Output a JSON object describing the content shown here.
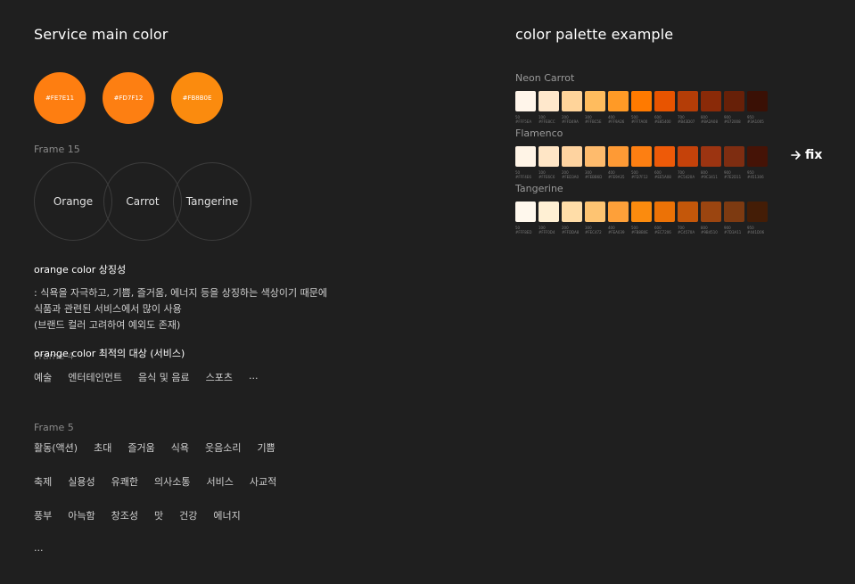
{
  "left": {
    "title": "Service main color",
    "main_colors": [
      {
        "hex": "#FE7E11",
        "label": "#FE7E11"
      },
      {
        "hex": "#FD7F12",
        "label": "#FD7F12"
      },
      {
        "hex": "#FB8B0E",
        "label": "#FB8B0E"
      }
    ],
    "frame15": {
      "label": "Frame 15",
      "rings": [
        "Orange",
        "Carrot",
        "Tangerine"
      ]
    },
    "symbolism": {
      "title": "orange color 상징성",
      "lines": [
        ": 식욕을 자극하고, 기쁨, 즐거움, 에너지 등을 상징하는 색상이기 때문에",
        "식품과 관련된 서비스에서 많이 사용",
        "(브랜드 컬러 고려하여 예외도 존재)"
      ]
    },
    "target": {
      "title": "orange color  최적의 대상 (서비스)",
      "frame_label": "Frame 4",
      "tags": [
        "예술",
        "엔터테인먼트",
        "음식 및 음료",
        "스포츠",
        "..."
      ]
    },
    "frame5": {
      "label": "Frame 5",
      "rows": [
        [
          "활동(액션)",
          "초대",
          "즐거움",
          "식욕",
          "웃음소리",
          "기쁨"
        ],
        [
          "축제",
          "실용성",
          "유쾌한",
          "의사소통",
          "서비스",
          "사교적"
        ],
        [
          "풍부",
          "아늑함",
          "창조성",
          "맛",
          "건강",
          "에너지"
        ]
      ],
      "ellipsis": "..."
    }
  },
  "right": {
    "title": "color palette example",
    "fix_label": "fix",
    "palettes": [
      {
        "name": "Neon Carrot",
        "colors": [
          "#FFF5EA",
          "#FFE8CC",
          "#FFD49A",
          "#FFBC5E",
          "#FF9A26",
          "#FF7A00",
          "#E85400",
          "#B43D07",
          "#8A2A08",
          "#672008",
          "#3A1005"
        ],
        "labels": [
          [
            "50",
            "#FFF5EA"
          ],
          [
            "100",
            "#FFE8CC"
          ],
          [
            "200",
            "#FFD49A"
          ],
          [
            "300",
            "#FFBC5E"
          ],
          [
            "400",
            "#FF9A26"
          ],
          [
            "500",
            "#FF7A00"
          ],
          [
            "600",
            "#E85400"
          ],
          [
            "700",
            "#B43D07"
          ],
          [
            "800",
            "#8A2A08"
          ],
          [
            "900",
            "#672008"
          ],
          [
            "950",
            "#3A1005"
          ]
        ]
      },
      {
        "name": "Flamenco",
        "colors": [
          "#FFF4E6",
          "#FFE6C6",
          "#FED3A0",
          "#FEBB6D",
          "#FE9A35",
          "#FD7F12",
          "#EE5A08",
          "#C5420A",
          "#9C3411",
          "#7E2D11",
          "#451306"
        ],
        "labels": [
          [
            "50",
            "#FFF4E6"
          ],
          [
            "100",
            "#FFE6C6"
          ],
          [
            "200",
            "#FED3A0"
          ],
          [
            "300",
            "#FEBB6D"
          ],
          [
            "400",
            "#FE9A35"
          ],
          [
            "500",
            "#FD7F12"
          ],
          [
            "600",
            "#EE5A08"
          ],
          [
            "700",
            "#C5420A"
          ],
          [
            "800",
            "#9C3411"
          ],
          [
            "900",
            "#7E2D11"
          ],
          [
            "950",
            "#451306"
          ]
        ]
      },
      {
        "name": "Tangerine",
        "colors": [
          "#FFF8ED",
          "#FFF0D4",
          "#FFDDA8",
          "#FEC472",
          "#FEA039",
          "#FB8B0E",
          "#EC7206",
          "#C4570A",
          "#9B4510",
          "#7D3A11",
          "#441D06"
        ],
        "labels": [
          [
            "50",
            "#FFF8ED"
          ],
          [
            "100",
            "#FFF0D4"
          ],
          [
            "200",
            "#FFDDA8"
          ],
          [
            "300",
            "#FEC472"
          ],
          [
            "400",
            "#FEA039"
          ],
          [
            "500",
            "#FB8B0E"
          ],
          [
            "600",
            "#EC7206"
          ],
          [
            "700",
            "#C4570A"
          ],
          [
            "800",
            "#9B4510"
          ],
          [
            "900",
            "#7D3A11"
          ],
          [
            "950",
            "#441D06"
          ]
        ]
      }
    ]
  }
}
